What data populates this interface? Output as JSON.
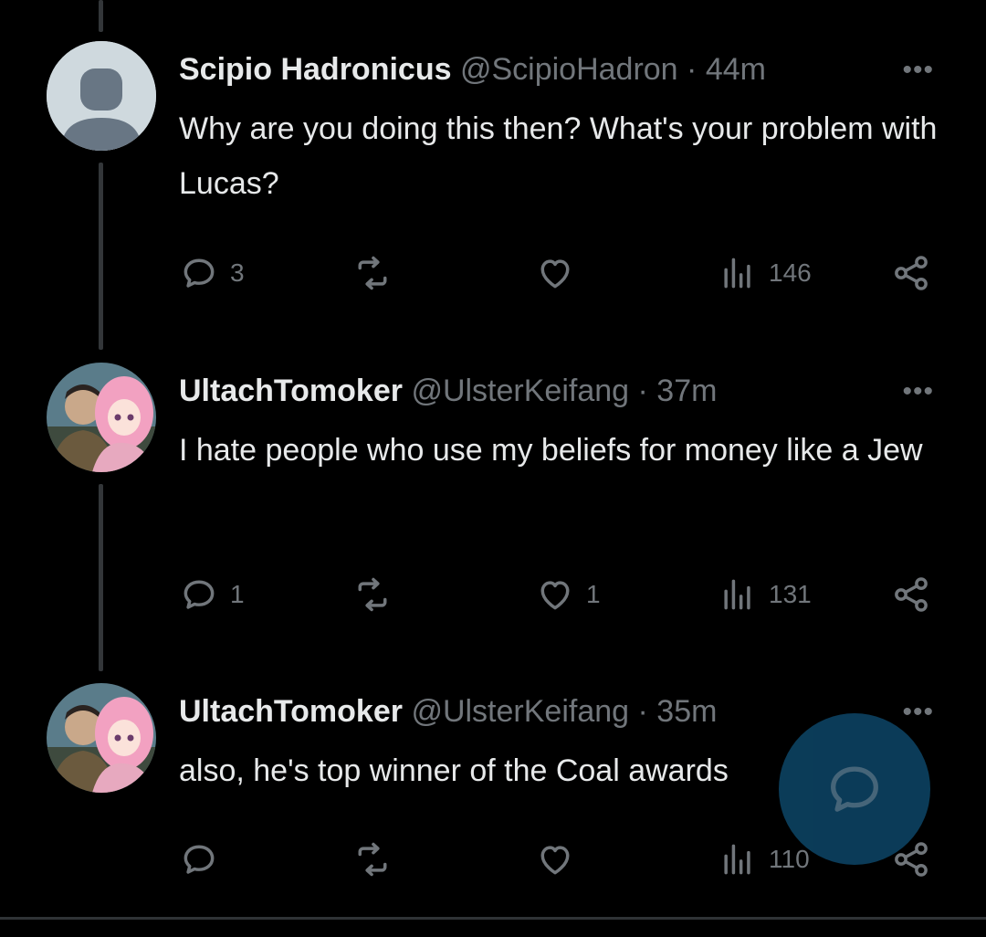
{
  "tweets": [
    {
      "display_name": "Scipio Hadronicus",
      "handle": "@ScipioHadron",
      "time": "44m",
      "avatar": "default-avatar",
      "text": "Why are you doing this then? What's your problem with Lucas?",
      "replies": "3",
      "retweets": "",
      "likes": "",
      "views": "146"
    },
    {
      "display_name": "UltachTomoker",
      "handle": "@UlsterKeifang",
      "time": "37m",
      "avatar": "photo-avatar",
      "text": "I hate people who use my beliefs for money like a Jew",
      "replies": "1",
      "retweets": "",
      "likes": "1",
      "views": "131"
    },
    {
      "display_name": "UltachTomoker",
      "handle": "@UlsterKeifang",
      "time": "35m",
      "avatar": "photo-avatar",
      "text": "also, he's top winner of the Coal awards",
      "replies": "",
      "retweets": "",
      "likes": "",
      "views": "110"
    }
  ],
  "separator": " · ",
  "more_glyph": "•••",
  "fab": {
    "icon": "compose-reply-icon",
    "color": "#0c3f5d"
  },
  "colors": {
    "background": "#000000",
    "text": "#e7e9ea",
    "muted": "#71767b",
    "thread_line": "#333639"
  }
}
